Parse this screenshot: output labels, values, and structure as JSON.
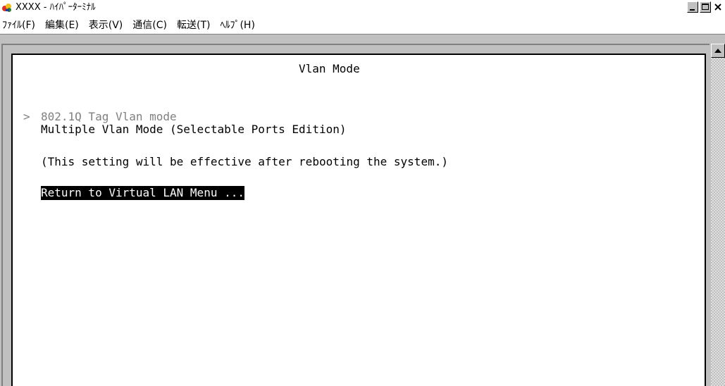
{
  "window": {
    "title": "XXXX - ﾊｲﾊﾟｰﾀｰﾐﾅﾙ",
    "icon": "hyperterminal-icon"
  },
  "menu": [
    {
      "label": "ﾌｧｲﾙ(F)"
    },
    {
      "label": "編集(E)"
    },
    {
      "label": "表示(V)"
    },
    {
      "label": "通信(C)"
    },
    {
      "label": "転送(T)"
    },
    {
      "label": "ﾍﾙﾌﾟ(H)"
    }
  ],
  "terminal": {
    "heading": "Vlan Mode",
    "cursor": ">",
    "options": [
      {
        "label": "802.1Q Tag Vlan mode",
        "state": "dim"
      },
      {
        "label": "Multiple Vlan Mode (Selectable Ports Edition)",
        "state": "normal"
      }
    ],
    "note": "(This setting will be effective after rebooting the system.)",
    "return_label": "Return to Virtual LAN Menu ..."
  }
}
